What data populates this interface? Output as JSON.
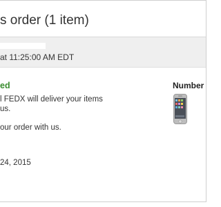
{
  "order": {
    "title": "s order (1 item)",
    "placed_time": "at 11:25:00 AM EDT",
    "status": "ed",
    "delivery_line1": "l FEDX will deliver your items",
    "delivery_line2": "us.",
    "thanks_line": "our order with us.",
    "date": "24, 2015"
  },
  "item_panel": {
    "label": "Number of",
    "product_icon": "smartphone-icon"
  },
  "colors": {
    "status_green": "#3a8d2f",
    "band_gray": "#efefef",
    "text": "#333333"
  }
}
